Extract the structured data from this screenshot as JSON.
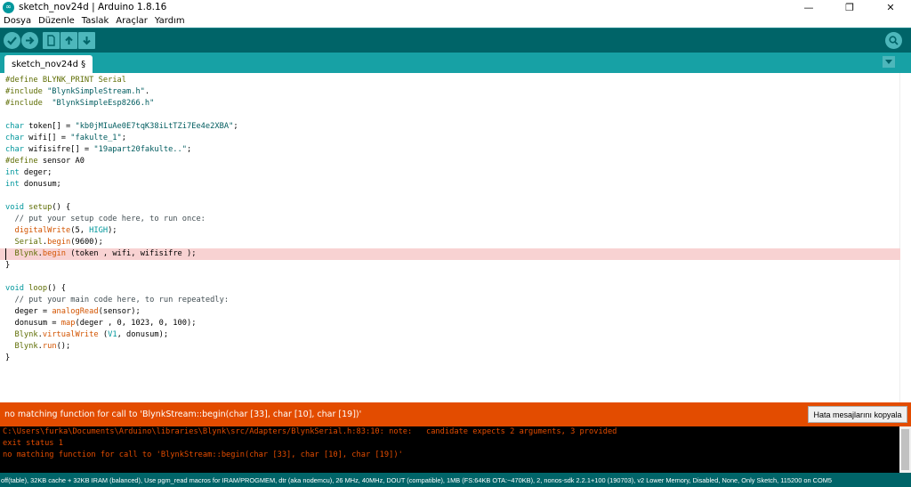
{
  "window": {
    "title": "sketch_nov24d | Arduino 1.8.16",
    "minimize": "—",
    "maximize": "❐",
    "close": "✕"
  },
  "menu": [
    "Dosya",
    "Düzenle",
    "Taslak",
    "Araçlar",
    "Yardım"
  ],
  "toolbar": {
    "verify_icon": "check-icon",
    "upload_icon": "arrow-right-icon",
    "new_icon": "new-file-icon",
    "open_icon": "arrow-up-icon",
    "save_icon": "arrow-down-icon",
    "serial_icon": "magnifier-icon"
  },
  "tab": {
    "label": "sketch_nov24d §"
  },
  "code": {
    "lines": [
      "#define BLYNK_PRINT Serial",
      "#include \"BlynkSimpleStream.h\".",
      "#include  \"BlynkSimpleEsp8266.h\"",
      "",
      "char token[] = \"kb0jMIuAe0E7tqK38iLtTZi7Ee4e2XBA\";",
      "char wifi[] = \"fakulte_1\";",
      "char wifisifre[] = \"19apart20fakulte..\";",
      "#define sensor A0",
      "int deger;",
      "int donusum;",
      "",
      "void setup() {",
      "  // put your setup code here, to run once:",
      "  digitalWrite(5, HIGH);",
      "  Serial.begin(9600);",
      "  Blynk.begin (token , wifi, wifisifre );",
      "}",
      "",
      "void loop() {",
      "  // put your main code here, to run repeatedly:",
      "  deger = analogRead(sensor);",
      "  donusum = map(deger , 0, 1023, 0, 100);",
      "  Blynk.virtualWrite (V1, donusum);",
      "  Blynk.run();",
      "}"
    ],
    "highlighted_line": 15
  },
  "status": {
    "message": "no matching function for call to 'BlynkStream::begin(char [33], char [10], char [19])'",
    "copy_button": "Hata mesajlarını kopyala"
  },
  "console": {
    "lines": [
      "C:\\Users\\furka\\Documents\\Arduino\\libraries\\Blynk\\src/Adapters/BlynkSerial.h:83:10: note:   candidate expects 2 arguments, 3 provided",
      "exit status 1",
      "no matching function for call to 'BlynkStream::begin(char [33], char [10], char [19])'"
    ]
  },
  "footer": {
    "board_info": "off(table), 32KB cache + 32KB IRAM (balanced), Use pgm_read macros for IRAM/PROGMEM, dtr (aka nodemcu), 26 MHz, 40MHz, DOUT (compatible), 1MB (FS:64KB OTA:~470KB), 2, nonos-sdk 2.2.1+100 (190703), v2 Lower Memory, Disabled, None, Only Sketch, 115200 on COM5"
  },
  "colors": {
    "toolbar": "#006468",
    "tabstrip": "#17a1a5",
    "error_bar": "#e34c00",
    "highlight": "#f8d2d2"
  }
}
